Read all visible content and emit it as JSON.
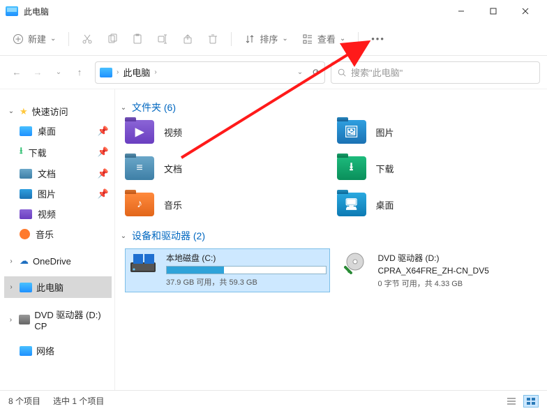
{
  "window": {
    "title": "此电脑"
  },
  "toolbar": {
    "new_label": "新建",
    "sort_label": "排序",
    "view_label": "查看"
  },
  "address": {
    "location": "此电脑"
  },
  "search": {
    "placeholder": "搜索\"此电脑\""
  },
  "sidebar": {
    "quick_label": "快速访问",
    "items": [
      {
        "label": "桌面"
      },
      {
        "label": "下载"
      },
      {
        "label": "文档"
      },
      {
        "label": "图片"
      },
      {
        "label": "视频"
      },
      {
        "label": "音乐"
      }
    ],
    "onedrive_label": "OneDrive",
    "thispc_label": "此电脑",
    "dvd_label": "DVD 驱动器 (D:) CP",
    "network_label": "网络"
  },
  "sections": {
    "folders_label": "文件夹 (6)",
    "drives_label": "设备和驱动器 (2)"
  },
  "folders": [
    {
      "label": "视频"
    },
    {
      "label": "图片"
    },
    {
      "label": "文档"
    },
    {
      "label": "下载"
    },
    {
      "label": "音乐"
    },
    {
      "label": "桌面"
    }
  ],
  "drives": {
    "c": {
      "name": "本地磁盘 (C:)",
      "detail": "37.9 GB 可用，共 59.3 GB",
      "fill_pct": 36
    },
    "d": {
      "name": "DVD 驱动器 (D:)",
      "sub": "CPRA_X64FRE_ZH-CN_DV5",
      "detail": "0 字节 可用，共 4.33 GB"
    }
  },
  "status": {
    "count": "8 个项目",
    "selection": "选中 1 个项目"
  }
}
